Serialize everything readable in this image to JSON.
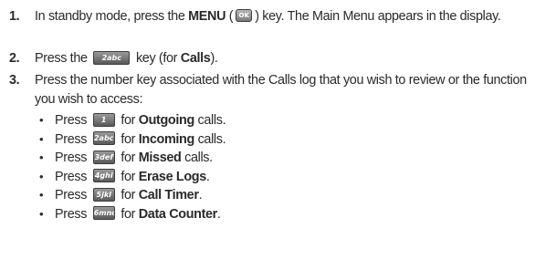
{
  "steps": [
    {
      "number": "1.",
      "part_a": "In standby mode, press the ",
      "bold": "MENU",
      "part_b": " (",
      "part_c": ") key. The Main Menu appears in the display."
    },
    {
      "number": "2.",
      "part_a": "Press the ",
      "part_b": " key (for ",
      "bold": "Calls",
      "part_c": ")."
    },
    {
      "number": "3.",
      "text": "Press the number key associated with the Calls log that you wish to review or the function you wish to access:"
    }
  ],
  "keys": {
    "ok": "OK",
    "k1": "1",
    "k2": "2abc",
    "k3": "3def",
    "k4": "4ghi",
    "k5": "5jkl",
    "k6": "6mno"
  },
  "bullets": [
    {
      "press": "Press",
      "for": "for",
      "bold": "Outgoing",
      "rest": " calls."
    },
    {
      "press": "Press",
      "for": "for",
      "bold": "Incoming",
      "rest": " calls."
    },
    {
      "press": "Press",
      "for": "for",
      "bold": "Missed",
      "rest": " calls."
    },
    {
      "press": "Press",
      "for": "for",
      "bold": "Erase Logs",
      "rest": "."
    },
    {
      "press": "Press",
      "for": "for",
      "bold": "Call Timer",
      "rest": "."
    },
    {
      "press": "Press",
      "for": "for",
      "bold": "Data Counter",
      "rest": "."
    }
  ],
  "bullet_char": "•"
}
